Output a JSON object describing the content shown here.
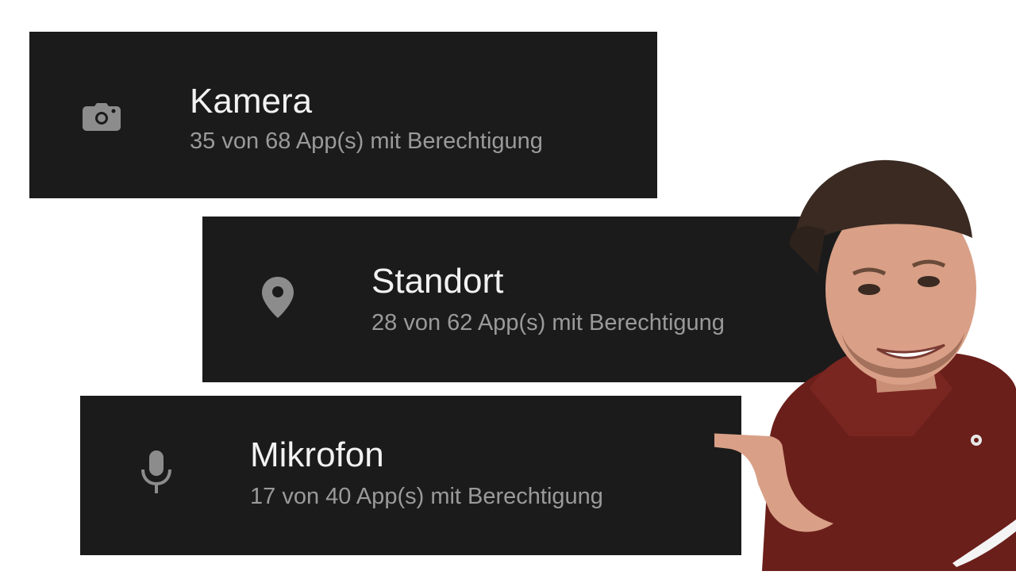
{
  "permissions": [
    {
      "icon": "camera-icon",
      "title": "Kamera",
      "subtitle": "35 von 68 App(s) mit Berechtigung"
    },
    {
      "icon": "location-pin-icon",
      "title": "Standort",
      "subtitle": "28 von 62 App(s) mit Berechtigung"
    },
    {
      "icon": "microphone-icon",
      "title": "Mikrofon",
      "subtitle": "17 von 40 App(s) mit Berechtigung"
    }
  ],
  "colors": {
    "card_background": "#1b1b1b",
    "title_text": "#f2f2f2",
    "subtitle_text": "#9a9a9a",
    "icon": "#8c8c8c",
    "page_background": "#ffffff"
  }
}
